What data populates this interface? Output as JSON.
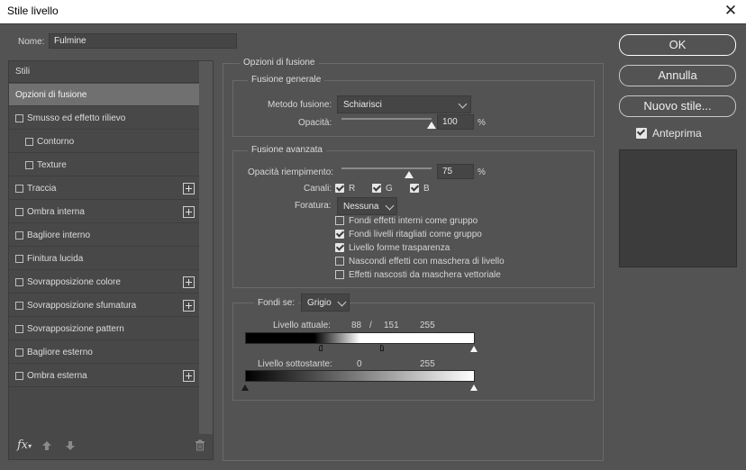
{
  "window": {
    "title": "Stile livello",
    "close_glyph": "✕"
  },
  "name_field": {
    "label": "Nome:",
    "value": "Fulmine"
  },
  "styles_list": {
    "header": "Stili",
    "items": [
      {
        "label": "Opzioni di fusione",
        "selected": true
      },
      {
        "label": "Smusso ed effetto rilievo",
        "checkbox": true
      },
      {
        "label": "Contorno",
        "checkbox": true,
        "indent": true
      },
      {
        "label": "Texture",
        "checkbox": true,
        "indent": true
      },
      {
        "label": "Traccia",
        "checkbox": true,
        "plus": true
      },
      {
        "label": "Ombra interna",
        "checkbox": true,
        "plus": true
      },
      {
        "label": "Bagliore interno",
        "checkbox": true
      },
      {
        "label": "Finitura lucida",
        "checkbox": true
      },
      {
        "label": "Sovrapposizione colore",
        "checkbox": true,
        "plus": true
      },
      {
        "label": "Sovrapposizione sfumatura",
        "checkbox": true,
        "plus": true
      },
      {
        "label": "Sovrapposizione pattern",
        "checkbox": true
      },
      {
        "label": "Bagliore esterno",
        "checkbox": true
      },
      {
        "label": "Ombra esterna",
        "checkbox": true,
        "plus": true
      }
    ],
    "footer_icons": [
      "fx-icon",
      "arrow-up-icon",
      "arrow-down-icon",
      "trash-icon"
    ],
    "fx_label": "fx"
  },
  "blending": {
    "title": "Opzioni di fusione",
    "general": {
      "title": "Fusione generale",
      "mode_label": "Metodo fusione:",
      "mode_value": "Schiarisci",
      "opacity_label": "Opacità:",
      "opacity_value": "100",
      "opacity_level": 100,
      "percent": "%"
    },
    "advanced": {
      "title": "Fusione avanzata",
      "fill_label": "Opacità riempimento:",
      "fill_value": "75",
      "fill_level": 75,
      "percent": "%",
      "channels_label": "Canali:",
      "channel_r": "R",
      "channel_g": "G",
      "channel_b": "B",
      "knockout_label": "Foratura:",
      "knockout_value": "Nessuna",
      "options": [
        {
          "label": "Fondi effetti interni come gruppo",
          "checked": false
        },
        {
          "label": "Fondi livelli ritagliati come gruppo",
          "checked": true
        },
        {
          "label": "Livello forme trasparenza",
          "checked": true
        },
        {
          "label": "Nascondi effetti con maschera di livello",
          "checked": false
        },
        {
          "label": "Effetti nascosti da maschera vettoriale",
          "checked": false
        }
      ]
    },
    "blend_if": {
      "label": "Fondi se:",
      "value": "Grigio",
      "this_layer_label": "Livello attuale:",
      "this_layer_low": "88",
      "this_layer_sep": "/",
      "this_layer_mid": "151",
      "this_layer_high": "255",
      "underlying_label": "Livello sottostante:",
      "underlying_low": "0",
      "underlying_high": "255"
    }
  },
  "buttons": {
    "ok": "OK",
    "cancel": "Annulla",
    "new_style": "Nuovo stile...",
    "preview": "Anteprima"
  }
}
